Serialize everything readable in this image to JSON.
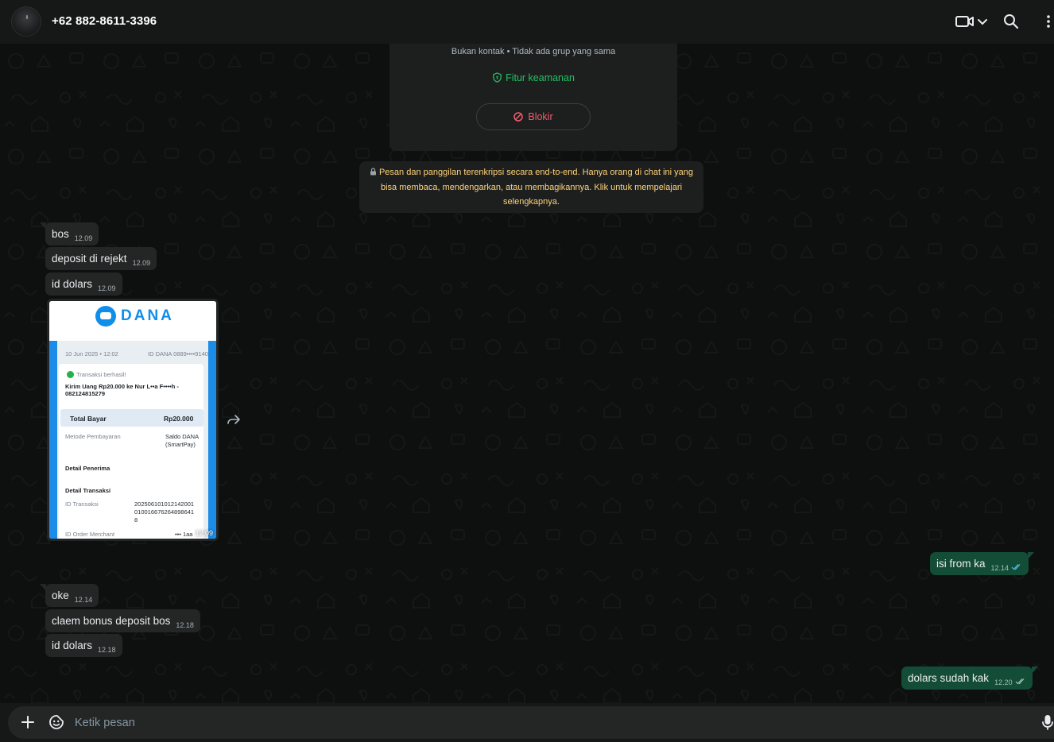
{
  "header": {
    "contact_name": "+62 882-8611-3396",
    "icons": [
      "video-call-icon",
      "chevron-down-icon",
      "search-icon",
      "more-options-icon"
    ]
  },
  "security_card": {
    "subtitle": "Bukan kontak • Tidak ada grup yang sama",
    "feature_label": "Fitur keamanan",
    "block_label": "Blokir"
  },
  "e2e_notice": {
    "text": "Pesan dan panggilan terenkripsi secara end-to-end. Hanya orang di chat ini yang bisa membaca, mendengarkan, atau membagikannya. Klik untuk mempelajari selengkapnya."
  },
  "messages": [
    {
      "dir": "in",
      "text": "bos",
      "time": "12.09"
    },
    {
      "dir": "in",
      "text": "deposit di rejekt",
      "time": "12.09"
    },
    {
      "dir": "in",
      "text": "id dolars",
      "time": "12.09"
    },
    {
      "dir": "out",
      "text": "isi from ka",
      "time": "12.14"
    },
    {
      "dir": "in",
      "text": "oke",
      "time": "12.14"
    },
    {
      "dir": "in",
      "text": "claem bonus deposit bos",
      "time": "12.18"
    },
    {
      "dir": "in",
      "text": "id dolars",
      "time": "12.18"
    },
    {
      "dir": "out",
      "text": "dolars sudah kak",
      "time": "12.20"
    }
  ],
  "image_message": {
    "time": "12.09",
    "receipt": {
      "brand": "DANA",
      "date": "10 Jun 2025 • 12:02",
      "account": "ID DANA 0889••••9140",
      "status": "Transaksi berhasil!",
      "description": "Kirim Uang Rp20.000 ke Nur L••a F••••h - 082124815279",
      "total_label": "Total Bayar",
      "total_value": "Rp20.000",
      "method_label": "Metode Pembayaran",
      "method_value": "Saldo DANA (SmartPay)",
      "recipient_section": "Detail Penerima",
      "transaction_section": "Detail Transaksi",
      "tx_id_label": "ID Transaksi",
      "tx_id_value": "2025061010121420010100166762648986418",
      "merchant_label": "ID Order Merchant",
      "merchant_value": "••• 1aa"
    }
  },
  "composer": {
    "placeholder": "Ketik pesan"
  },
  "colors": {
    "accent_green": "#21c063",
    "outgoing_bubble": "#144d37",
    "incoming_bubble": "#242626",
    "block_red": "#f15c6d",
    "notice_yellow": "#ffd279",
    "read_ticks": "#53bdeb"
  }
}
